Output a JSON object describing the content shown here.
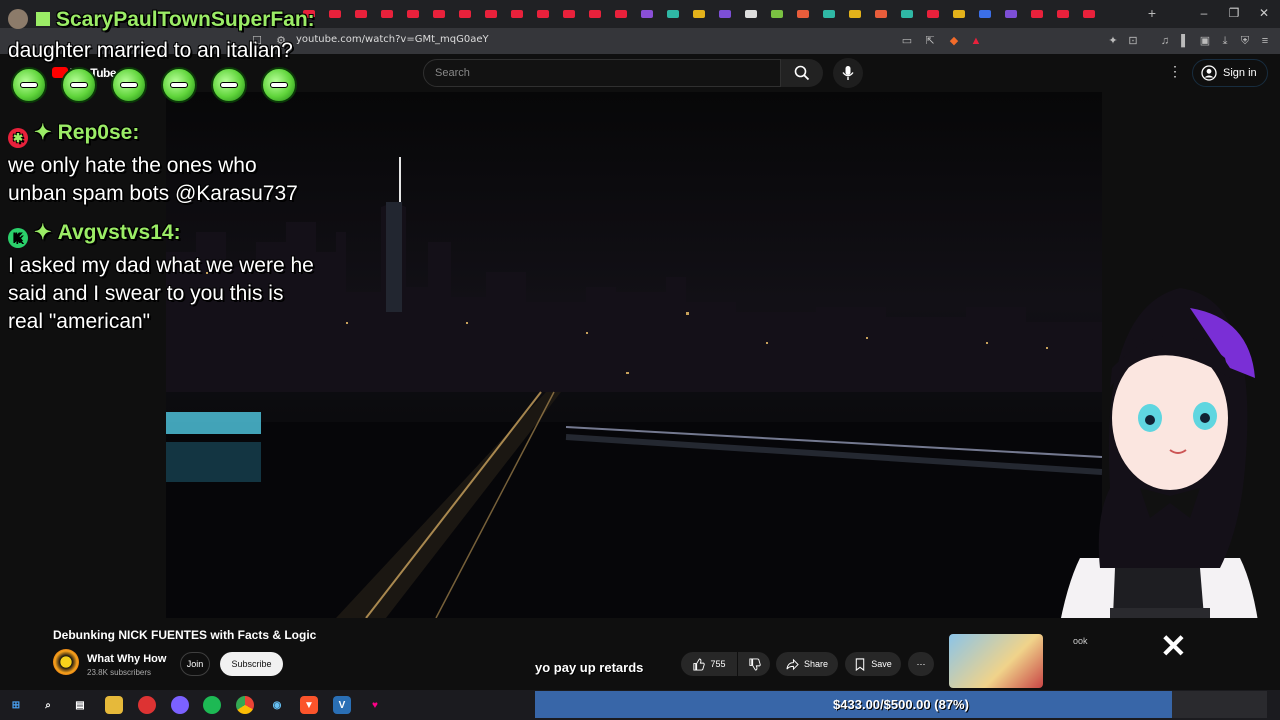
{
  "browser": {
    "url": "youtube.com/watch?v=GMt_mqG0aeY",
    "tab_colors": [
      "#e8213b",
      "#e8213b",
      "#e8213b",
      "#e8213b",
      "#e8213b",
      "#e8213b",
      "#e8213b",
      "#e8213b",
      "#e8213b",
      "#e8213b",
      "#e8213b",
      "#e8213b",
      "#e8213b",
      "#8a4fd6",
      "#2fb8a5",
      "#e3b21a",
      "#7d4fd6",
      "#dddddd",
      "#7ac142",
      "#e85d3b",
      "#2fb8a5",
      "#e3b21a",
      "#e85d3b",
      "#2fb8a5",
      "#e8213b",
      "#e3b21a",
      "#3b6fe8",
      "#7d4fd6",
      "#e8213b",
      "#e8213b",
      "#e8213b"
    ]
  },
  "header": {
    "logo_text": "YouTube",
    "search_placeholder": "Search",
    "signin_label": "Sign in"
  },
  "chat": {
    "top_author": "ScaryPaulTownSuperFan:",
    "top_message": "daughter married to an italian?",
    "messages": [
      {
        "author": "Rep0se:",
        "badge_color": "#e8213b",
        "text": [
          "we only hate the ones who",
          "unban spam bots @Karasu737"
        ]
      },
      {
        "author": "Avgvstvs14:",
        "badge_color": "#2bd16b",
        "badge_letter": "K",
        "text": [
          "I asked my dad what we were he",
          "said and I swear to you this is",
          "real \"american\""
        ]
      }
    ]
  },
  "video": {
    "title": "Debunking NICK FUENTES with Facts & Logic",
    "channel": "What Why How",
    "subscribers": "23.8K subscribers",
    "join_label": "Join",
    "subscribe_label": "Subscribe",
    "likes": "755",
    "share_label": "Share",
    "save_label": "Save",
    "overlay_text": "yo pay up retards",
    "card_label": "ook"
  },
  "donation_goal": {
    "text": "$433.00/$500.00 (87%)",
    "progress": 0.87,
    "color": "#3866a8"
  }
}
